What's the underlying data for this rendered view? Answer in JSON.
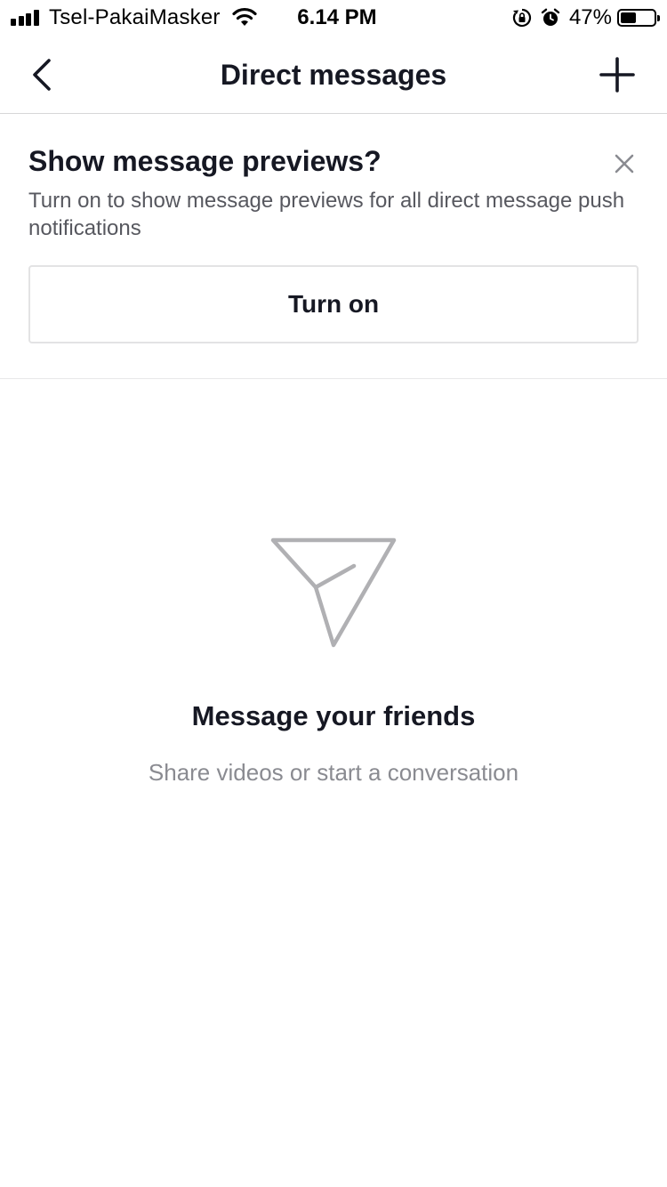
{
  "status_bar": {
    "carrier": "Tsel-PakaiMasker",
    "time": "6.14 PM",
    "battery_percent": "47%",
    "battery_level": 0.47,
    "icons": [
      "signal-icon",
      "wifi-icon",
      "rotation-lock-icon",
      "alarm-icon",
      "battery-icon"
    ]
  },
  "header": {
    "title": "Direct messages",
    "back_icon": "chevron-left-icon",
    "add_icon": "plus-icon"
  },
  "preview_banner": {
    "title": "Show message previews?",
    "description": "Turn on to show message previews for all direct message push notifications",
    "button_label": "Turn on",
    "close_icon": "close-icon"
  },
  "empty_state": {
    "icon": "paper-plane-icon",
    "title": "Message your friends",
    "subtitle": "Share videos or start a conversation"
  },
  "colors": {
    "text_primary": "#161823",
    "text_secondary": "#57585f",
    "text_muted": "#8a8b91",
    "icon_muted": "#b0b0b3",
    "divider": "#d6d6d8"
  }
}
